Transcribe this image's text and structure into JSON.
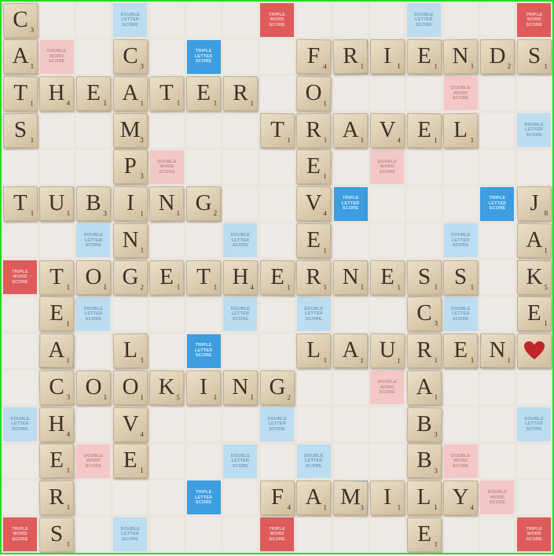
{
  "premium_labels": {
    "DW": "DOUBLE WORD SCORE",
    "TW": "TRIPLE WORD SCORE",
    "DL": "DOUBLE LETTER SCORE",
    "TL": "TRIPLE LETTER SCORE"
  },
  "premium_squares": [
    {
      "row": 0,
      "col": 3,
      "type": "DL"
    },
    {
      "row": 0,
      "col": 7,
      "type": "TW"
    },
    {
      "row": 0,
      "col": 11,
      "type": "DL"
    },
    {
      "row": 0,
      "col": 14,
      "type": "TW"
    },
    {
      "row": 1,
      "col": 1,
      "type": "DW"
    },
    {
      "row": 1,
      "col": 5,
      "type": "TL"
    },
    {
      "row": 1,
      "col": 9,
      "type": "TL"
    },
    {
      "row": 1,
      "col": 13,
      "type": "DW"
    },
    {
      "row": 2,
      "col": 2,
      "type": "DW"
    },
    {
      "row": 2,
      "col": 6,
      "type": "DL"
    },
    {
      "row": 2,
      "col": 8,
      "type": "DL"
    },
    {
      "row": 2,
      "col": 12,
      "type": "DW"
    },
    {
      "row": 3,
      "col": 0,
      "type": "DL"
    },
    {
      "row": 3,
      "col": 3,
      "type": "DW"
    },
    {
      "row": 3,
      "col": 7,
      "type": "DL"
    },
    {
      "row": 3,
      "col": 11,
      "type": "DW"
    },
    {
      "row": 3,
      "col": 14,
      "type": "DL"
    },
    {
      "row": 4,
      "col": 4,
      "type": "DW"
    },
    {
      "row": 4,
      "col": 10,
      "type": "DW"
    },
    {
      "row": 5,
      "col": 1,
      "type": "TL"
    },
    {
      "row": 5,
      "col": 5,
      "type": "TL"
    },
    {
      "row": 5,
      "col": 9,
      "type": "TL"
    },
    {
      "row": 5,
      "col": 13,
      "type": "TL"
    },
    {
      "row": 6,
      "col": 2,
      "type": "DL"
    },
    {
      "row": 6,
      "col": 6,
      "type": "DL"
    },
    {
      "row": 6,
      "col": 8,
      "type": "DL"
    },
    {
      "row": 6,
      "col": 12,
      "type": "DL"
    },
    {
      "row": 7,
      "col": 0,
      "type": "TW"
    },
    {
      "row": 7,
      "col": 3,
      "type": "DL"
    },
    {
      "row": 7,
      "col": 7,
      "type": "DW"
    },
    {
      "row": 7,
      "col": 11,
      "type": "DL"
    },
    {
      "row": 7,
      "col": 14,
      "type": "TW"
    },
    {
      "row": 8,
      "col": 2,
      "type": "DL"
    },
    {
      "row": 8,
      "col": 6,
      "type": "DL"
    },
    {
      "row": 8,
      "col": 8,
      "type": "DL"
    },
    {
      "row": 8,
      "col": 12,
      "type": "DL"
    },
    {
      "row": 9,
      "col": 1,
      "type": "TL"
    },
    {
      "row": 9,
      "col": 5,
      "type": "TL"
    },
    {
      "row": 9,
      "col": 9,
      "type": "TL"
    },
    {
      "row": 9,
      "col": 13,
      "type": "TL"
    },
    {
      "row": 10,
      "col": 4,
      "type": "DW"
    },
    {
      "row": 10,
      "col": 10,
      "type": "DW"
    },
    {
      "row": 11,
      "col": 0,
      "type": "DL"
    },
    {
      "row": 11,
      "col": 3,
      "type": "DW"
    },
    {
      "row": 11,
      "col": 7,
      "type": "DL"
    },
    {
      "row": 11,
      "col": 11,
      "type": "DW"
    },
    {
      "row": 11,
      "col": 14,
      "type": "DL"
    },
    {
      "row": 12,
      "col": 2,
      "type": "DW"
    },
    {
      "row": 12,
      "col": 6,
      "type": "DL"
    },
    {
      "row": 12,
      "col": 8,
      "type": "DL"
    },
    {
      "row": 12,
      "col": 12,
      "type": "DW"
    },
    {
      "row": 13,
      "col": 1,
      "type": "DW"
    },
    {
      "row": 13,
      "col": 5,
      "type": "TL"
    },
    {
      "row": 13,
      "col": 9,
      "type": "TL"
    },
    {
      "row": 13,
      "col": 13,
      "type": "DW"
    },
    {
      "row": 14,
      "col": 0,
      "type": "TW"
    },
    {
      "row": 14,
      "col": 3,
      "type": "DL"
    },
    {
      "row": 14,
      "col": 7,
      "type": "TW"
    },
    {
      "row": 14,
      "col": 11,
      "type": "DL"
    },
    {
      "row": 14,
      "col": 14,
      "type": "TW"
    }
  ],
  "tiles": [
    {
      "row": 0,
      "col": 0,
      "letter": "C",
      "points": "3"
    },
    {
      "row": 1,
      "col": 0,
      "letter": "A",
      "points": "1"
    },
    {
      "row": 1,
      "col": 3,
      "letter": "C",
      "points": "3"
    },
    {
      "row": 1,
      "col": 8,
      "letter": "F",
      "points": "4"
    },
    {
      "row": 1,
      "col": 9,
      "letter": "R",
      "points": "1"
    },
    {
      "row": 1,
      "col": 10,
      "letter": "I",
      "points": "1"
    },
    {
      "row": 1,
      "col": 11,
      "letter": "E",
      "points": "1"
    },
    {
      "row": 1,
      "col": 12,
      "letter": "N",
      "points": "1"
    },
    {
      "row": 1,
      "col": 13,
      "letter": "D",
      "points": "2"
    },
    {
      "row": 1,
      "col": 14,
      "letter": "S",
      "points": "1"
    },
    {
      "row": 2,
      "col": 0,
      "letter": "T",
      "points": "1"
    },
    {
      "row": 2,
      "col": 1,
      "letter": "H",
      "points": "4"
    },
    {
      "row": 2,
      "col": 2,
      "letter": "E",
      "points": "1"
    },
    {
      "row": 2,
      "col": 3,
      "letter": "A",
      "points": "1"
    },
    {
      "row": 2,
      "col": 4,
      "letter": "T",
      "points": "1"
    },
    {
      "row": 2,
      "col": 5,
      "letter": "E",
      "points": "1"
    },
    {
      "row": 2,
      "col": 6,
      "letter": "R",
      "points": "1"
    },
    {
      "row": 2,
      "col": 8,
      "letter": "O",
      "points": "1"
    },
    {
      "row": 3,
      "col": 0,
      "letter": "S",
      "points": "1"
    },
    {
      "row": 3,
      "col": 3,
      "letter": "M",
      "points": "3"
    },
    {
      "row": 3,
      "col": 7,
      "letter": "T",
      "points": "1"
    },
    {
      "row": 3,
      "col": 8,
      "letter": "R",
      "points": "1"
    },
    {
      "row": 3,
      "col": 9,
      "letter": "A",
      "points": "1"
    },
    {
      "row": 3,
      "col": 10,
      "letter": "V",
      "points": "4"
    },
    {
      "row": 3,
      "col": 11,
      "letter": "E",
      "points": "1"
    },
    {
      "row": 3,
      "col": 12,
      "letter": "L",
      "points": "1"
    },
    {
      "row": 4,
      "col": 3,
      "letter": "P",
      "points": "3"
    },
    {
      "row": 4,
      "col": 8,
      "letter": "E",
      "points": "1"
    },
    {
      "row": 5,
      "col": 0,
      "letter": "T",
      "points": "1"
    },
    {
      "row": 5,
      "col": 1,
      "letter": "U",
      "points": "1"
    },
    {
      "row": 5,
      "col": 2,
      "letter": "B",
      "points": "3"
    },
    {
      "row": 5,
      "col": 3,
      "letter": "I",
      "points": "1"
    },
    {
      "row": 5,
      "col": 4,
      "letter": "N",
      "points": "1"
    },
    {
      "row": 5,
      "col": 5,
      "letter": "G",
      "points": "2"
    },
    {
      "row": 5,
      "col": 8,
      "letter": "V",
      "points": "4"
    },
    {
      "row": 5,
      "col": 14,
      "letter": "J",
      "points": "8"
    },
    {
      "row": 6,
      "col": 3,
      "letter": "N",
      "points": "1"
    },
    {
      "row": 6,
      "col": 8,
      "letter": "E",
      "points": "1"
    },
    {
      "row": 6,
      "col": 14,
      "letter": "A",
      "points": "1"
    },
    {
      "row": 7,
      "col": 1,
      "letter": "T",
      "points": "1"
    },
    {
      "row": 7,
      "col": 2,
      "letter": "O",
      "points": "1"
    },
    {
      "row": 7,
      "col": 3,
      "letter": "G",
      "points": "2"
    },
    {
      "row": 7,
      "col": 4,
      "letter": "E",
      "points": "1"
    },
    {
      "row": 7,
      "col": 5,
      "letter": "T",
      "points": "1"
    },
    {
      "row": 7,
      "col": 6,
      "letter": "H",
      "points": "4"
    },
    {
      "row": 7,
      "col": 7,
      "letter": "E",
      "points": "1"
    },
    {
      "row": 7,
      "col": 8,
      "letter": "R",
      "points": "1"
    },
    {
      "row": 7,
      "col": 9,
      "letter": "N",
      "points": "1"
    },
    {
      "row": 7,
      "col": 10,
      "letter": "E",
      "points": "1"
    },
    {
      "row": 7,
      "col": 11,
      "letter": "S",
      "points": "1"
    },
    {
      "row": 7,
      "col": 12,
      "letter": "S",
      "points": "1"
    },
    {
      "row": 7,
      "col": 14,
      "letter": "K",
      "points": "5"
    },
    {
      "row": 8,
      "col": 1,
      "letter": "E",
      "points": "1"
    },
    {
      "row": 8,
      "col": 11,
      "letter": "C",
      "points": "3"
    },
    {
      "row": 8,
      "col": 14,
      "letter": "E",
      "points": "1"
    },
    {
      "row": 9,
      "col": 1,
      "letter": "A",
      "points": "1"
    },
    {
      "row": 9,
      "col": 3,
      "letter": "L",
      "points": "1"
    },
    {
      "row": 9,
      "col": 8,
      "letter": "L",
      "points": "1"
    },
    {
      "row": 9,
      "col": 9,
      "letter": "A",
      "points": "1"
    },
    {
      "row": 9,
      "col": 10,
      "letter": "U",
      "points": "1"
    },
    {
      "row": 9,
      "col": 11,
      "letter": "R",
      "points": "1"
    },
    {
      "row": 9,
      "col": 12,
      "letter": "E",
      "points": "1"
    },
    {
      "row": 9,
      "col": 13,
      "letter": "N",
      "points": "1"
    },
    {
      "row": 10,
      "col": 1,
      "letter": "C",
      "points": "3"
    },
    {
      "row": 10,
      "col": 2,
      "letter": "O",
      "points": "1"
    },
    {
      "row": 10,
      "col": 3,
      "letter": "O",
      "points": "1"
    },
    {
      "row": 10,
      "col": 4,
      "letter": "K",
      "points": "5"
    },
    {
      "row": 10,
      "col": 5,
      "letter": "I",
      "points": "1"
    },
    {
      "row": 10,
      "col": 6,
      "letter": "N",
      "points": "1"
    },
    {
      "row": 10,
      "col": 7,
      "letter": "G",
      "points": "2"
    },
    {
      "row": 10,
      "col": 11,
      "letter": "A",
      "points": "1"
    },
    {
      "row": 11,
      "col": 1,
      "letter": "H",
      "points": "4"
    },
    {
      "row": 11,
      "col": 3,
      "letter": "V",
      "points": "4"
    },
    {
      "row": 11,
      "col": 11,
      "letter": "B",
      "points": "3"
    },
    {
      "row": 12,
      "col": 1,
      "letter": "E",
      "points": "1"
    },
    {
      "row": 12,
      "col": 3,
      "letter": "E",
      "points": "1"
    },
    {
      "row": 12,
      "col": 11,
      "letter": "B",
      "points": "3"
    },
    {
      "row": 13,
      "col": 1,
      "letter": "R",
      "points": "1"
    },
    {
      "row": 13,
      "col": 7,
      "letter": "F",
      "points": "4"
    },
    {
      "row": 13,
      "col": 8,
      "letter": "A",
      "points": "1"
    },
    {
      "row": 13,
      "col": 9,
      "letter": "M",
      "points": "3"
    },
    {
      "row": 13,
      "col": 10,
      "letter": "I",
      "points": "1"
    },
    {
      "row": 13,
      "col": 11,
      "letter": "L",
      "points": "1"
    },
    {
      "row": 13,
      "col": 12,
      "letter": "Y",
      "points": "4"
    },
    {
      "row": 14,
      "col": 1,
      "letter": "S",
      "points": "1"
    },
    {
      "row": 14,
      "col": 11,
      "letter": "E",
      "points": "1"
    }
  ],
  "decorations": [
    {
      "row": 9,
      "col": 14,
      "type": "heart-icon",
      "color": "#c0252c"
    }
  ],
  "colors": {
    "board": "#e9e4de",
    "square": "#ede9e4",
    "double_word": "#f4c7c7",
    "triple_word": "#de5b5b",
    "double_letter": "#bcdcef",
    "triple_letter": "#3d9ddf",
    "tile": "#dccdb1",
    "frame": "#22dd22"
  }
}
